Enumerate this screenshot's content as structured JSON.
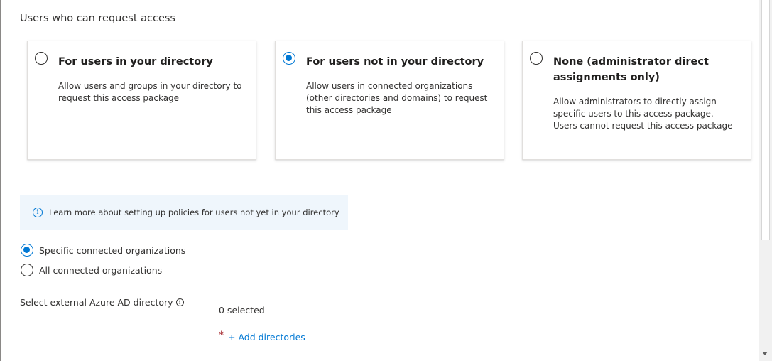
{
  "section": {
    "title": "Users who can request access"
  },
  "cards": [
    {
      "title": "For users in your directory",
      "description": "Allow users and groups in your directory to request this access package",
      "selected": false
    },
    {
      "title": "For users not in your directory",
      "description": "Allow users in connected organizations (other directories and domains) to request this access package",
      "selected": true
    },
    {
      "title": "None (administrator direct assignments only)",
      "description": "Allow administrators to directly assign specific users to this access package. Users cannot request this access package",
      "selected": false
    }
  ],
  "info_bar": {
    "icon": "info-icon",
    "text": "Learn more about setting up policies for users not yet in your directory"
  },
  "org_options": [
    {
      "label": "Specific connected organizations",
      "selected": true
    },
    {
      "label": "All connected organizations",
      "selected": false
    }
  ],
  "directory_field": {
    "label": "Select external Azure AD directory",
    "info_icon": "info-icon",
    "selected_count": "0 selected",
    "required_marker": "*",
    "add_link": "+ Add directories"
  },
  "colors": {
    "accent": "#0078d4",
    "info_background": "#eff6fc",
    "required": "#a4262c"
  }
}
